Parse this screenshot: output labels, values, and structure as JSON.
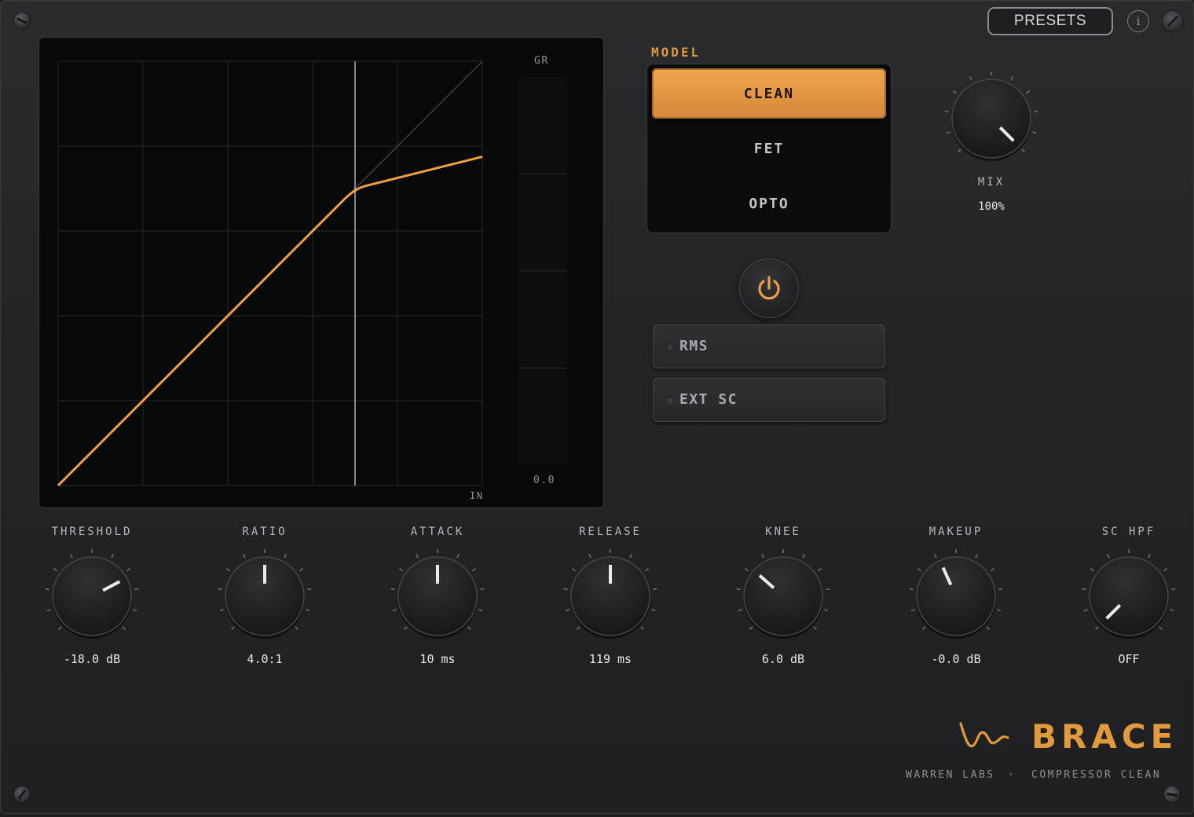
{
  "header": {
    "presets_label": "PRESETS",
    "info_label": "i"
  },
  "display": {
    "gr_label": "GR",
    "in_label": "IN",
    "gr_value": "0.0",
    "curve": {
      "threshold_frac": 0.7,
      "ratio": 4.0,
      "knee_frac": 0.05,
      "color": "#f0a040",
      "cursor_in_frac": 0.7,
      "grid_divisions": 5
    },
    "gr_meter_fraction": 0
  },
  "model": {
    "label": "MODEL",
    "options": [
      "CLEAN",
      "FET",
      "OPTO"
    ],
    "selected": "CLEAN"
  },
  "toggles": {
    "rms": {
      "label": "RMS",
      "on": false
    },
    "ext_sc": {
      "label": "EXT SC",
      "on": false
    }
  },
  "power": {
    "on": true
  },
  "mix": {
    "label": "MIX",
    "value": "100%",
    "fraction": 1.0
  },
  "knobs": [
    {
      "label": "THRESHOLD",
      "value": "-18.0 dB",
      "fraction": 0.73
    },
    {
      "label": "RATIO",
      "value": "4.0:1",
      "fraction": 0.5
    },
    {
      "label": "ATTACK",
      "value": "10 ms",
      "fraction": 0.5
    },
    {
      "label": "RELEASE",
      "value": "119 ms",
      "fraction": 0.5
    },
    {
      "label": "KNEE",
      "value": "6.0 dB",
      "fraction": 0.32
    },
    {
      "label": "MAKEUP",
      "value": "-0.0 dB",
      "fraction": 0.41
    },
    {
      "label": "SC HPF",
      "value": "OFF",
      "fraction": 0.0
    }
  ],
  "brand": {
    "name": "BRACE",
    "maker": "WARREN LABS",
    "separator": "·",
    "product": "COMPRESSOR CLEAN"
  },
  "colors": {
    "accent": "#e39a3b",
    "panel": "#232427",
    "display_bg": "#08090b"
  }
}
